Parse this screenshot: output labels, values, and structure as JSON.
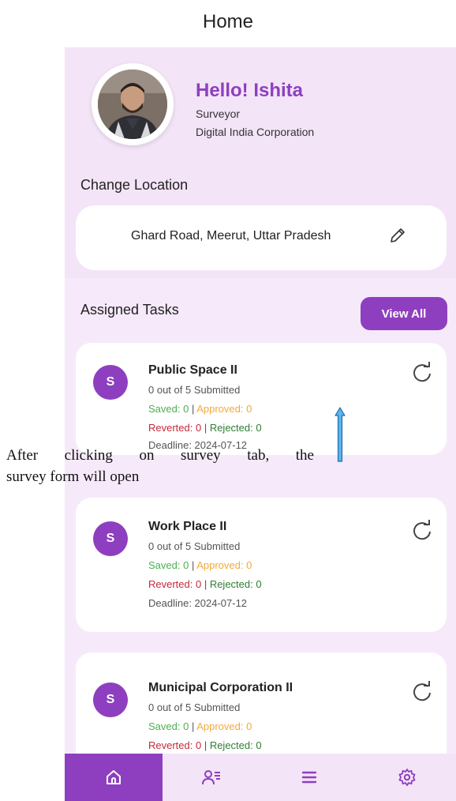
{
  "header": {
    "title": "Home"
  },
  "profile": {
    "greeting": "Hello! Ishita",
    "role": "Surveyor",
    "organization": "Digital India Corporation"
  },
  "location": {
    "label": "Change Location",
    "value": "Ghard Road, Meerut, Uttar Pradesh"
  },
  "tasks": {
    "title": "Assigned Tasks",
    "view_all_label": "View All",
    "items": [
      {
        "initial": "S",
        "name": "Public Space II",
        "submitted": "0 out of 5 Submitted",
        "saved": "Saved: 0",
        "approved": "Approved: 0",
        "reverted": "Reverted: 0",
        "rejected": "Rejected: 0",
        "deadline": "Deadline: 2024-07-12"
      },
      {
        "initial": "S",
        "name": "Work Place II",
        "submitted": "0 out of 5 Submitted",
        "saved": "Saved: 0",
        "approved": "Approved: 0",
        "reverted": "Reverted: 0",
        "rejected": "Rejected: 0",
        "deadline": "Deadline: 2024-07-12"
      },
      {
        "initial": "S",
        "name": "Municipal Corporation II",
        "submitted": "0 out of 5 Submitted",
        "saved": "Saved: 0",
        "approved": "Approved: 0",
        "reverted": "Reverted: 0",
        "rejected": "Rejected: 0"
      }
    ]
  },
  "bottom_nav": [
    {
      "icon": "home-icon",
      "active": true
    },
    {
      "icon": "users-list-icon",
      "active": false
    },
    {
      "icon": "menu-icon",
      "active": false
    },
    {
      "icon": "settings-gear-icon",
      "active": false
    }
  ],
  "annotation": {
    "line1": "After clicking on survey tab, the",
    "line2": "survey form will open"
  },
  "colors": {
    "accent": "#8e3fbf",
    "background": "#f6eafa",
    "saved": "#4caf50",
    "approved": "#f2a93b",
    "reverted": "#c62839",
    "rejected": "#2e7d32",
    "annotation_arrow": "#1e90d6"
  }
}
